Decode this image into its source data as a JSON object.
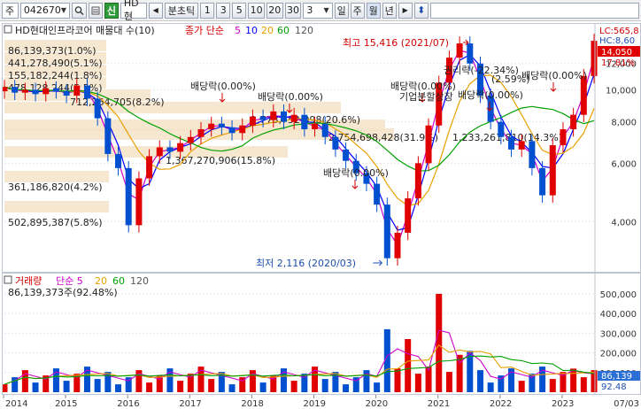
{
  "toolbar": {
    "market": "주",
    "code": "042670",
    "search_icon": "magnifier-icon",
    "credit_badge": "신",
    "name": "HD현",
    "period_prev": "◀",
    "period_label": "분초틱",
    "periods": [
      "1",
      "3",
      "5",
      "10",
      "20",
      "30"
    ],
    "count": "3",
    "day_label": "일",
    "week_label": "주",
    "month_label": "월",
    "year_label": "년",
    "next_arrow": "▶",
    "updown_icon": "updown-arrows-icon"
  },
  "price_panel": {
    "title": "HD현대인프라코어 매물대 수(10)",
    "legend_ma": [
      {
        "label": "종가 단순",
        "color": "#d80000"
      },
      {
        "label": "5",
        "color": "#cc00cc"
      },
      {
        "label": "10",
        "color": "#0000ff"
      },
      {
        "label": "20",
        "color": "#e8a000"
      },
      {
        "label": "60",
        "color": "#00a000"
      },
      {
        "label": "120",
        "color": "#555555"
      }
    ],
    "right_labels": {
      "lc": "LC:565,8",
      "hc": "HC:8,60",
      "current": "14,050",
      "ratio": "17.81%"
    },
    "y_ticks": [
      "12,000",
      "10,000",
      "8,000",
      "6,000",
      "4,000"
    ],
    "volume_profile": [
      "86,139,373(1.0%)",
      "441,278,490(5.1%)",
      "155,182,244(1.8%)",
      "478,128,244(5.5%)",
      "712,264,705(8.2%)",
      "1,778,752,098(20.6%)",
      "2,754,698,428(31.9%)",
      "1,233,261,810(14.3%)",
      "1,367,270,906(15.8%)",
      "361,186,820(4.2%)",
      "502,895,387(5.8%)"
    ],
    "dividend_labels": [
      "배당락(0.00%)",
      "배당락(0.00%)",
      "배당락(0.00%)",
      "배당락(0.00%)",
      "배당락(0.00%)",
      "배당락(0.00%)"
    ],
    "rights_label": "권리락(-22.34%)",
    "other_labels": [
      "(2.59%)",
      "기업분할상장",
      "배당락"
    ],
    "high_label": "최고 15,416 (2021/07)",
    "low_label": "최저 2,116 (2020/03)"
  },
  "volume_panel": {
    "title": "거래량",
    "legend": [
      {
        "label": "단순 5",
        "color": "#cc00cc"
      },
      {
        "label": "20",
        "color": "#e8a000"
      },
      {
        "label": "60",
        "color": "#00a000"
      },
      {
        "label": "120",
        "color": "#555555"
      }
    ],
    "current": "86,139,373주(92.48%)",
    "y_ticks": [
      "500,000",
      "400,000",
      "300,000",
      "200,000",
      "100,000"
    ],
    "right_labels": {
      "value": "86,139",
      "ratio": "92.48"
    }
  },
  "x_axis": {
    "labels": [
      "2014",
      "2015",
      "2016",
      "2017",
      "2018",
      "2019",
      "2020",
      "2021",
      "2022",
      "2023"
    ],
    "end_label": "07/03"
  },
  "colors": {
    "up": "#e00000",
    "down": "#0050d0",
    "profile": "#f5e3c8",
    "profile_text": "#7a4a00"
  },
  "chart_data": {
    "type": "candlestick",
    "title": "HD현대인프라코어 매물대 수(10)",
    "y_scale": "log",
    "y_range": [
      3000,
      14000
    ],
    "x_range": [
      "2014",
      "2023/07"
    ],
    "high": {
      "value": 15416,
      "date": "2021/07"
    },
    "low": {
      "value": 2116,
      "date": "2020/03"
    },
    "last_close": 14050,
    "monthly_close": [
      {
        "d": "2014-01",
        "c": 10200
      },
      {
        "d": "2014-03",
        "c": 9800
      },
      {
        "d": "2014-05",
        "c": 10000
      },
      {
        "d": "2014-07",
        "c": 9700
      },
      {
        "d": "2014-09",
        "c": 10100
      },
      {
        "d": "2014-11",
        "c": 9900
      },
      {
        "d": "2015-01",
        "c": 9600
      },
      {
        "d": "2015-03",
        "c": 10300
      },
      {
        "d": "2015-05",
        "c": 9400
      },
      {
        "d": "2015-07",
        "c": 8200
      },
      {
        "d": "2015-09",
        "c": 6400
      },
      {
        "d": "2015-11",
        "c": 5800
      },
      {
        "d": "2016-01",
        "c": 3900
      },
      {
        "d": "2016-03",
        "c": 5400
      },
      {
        "d": "2016-05",
        "c": 6300
      },
      {
        "d": "2016-07",
        "c": 6700
      },
      {
        "d": "2016-09",
        "c": 6500
      },
      {
        "d": "2016-11",
        "c": 6900
      },
      {
        "d": "2017-01",
        "c": 7200
      },
      {
        "d": "2017-03",
        "c": 7600
      },
      {
        "d": "2017-05",
        "c": 7900
      },
      {
        "d": "2017-07",
        "c": 7700
      },
      {
        "d": "2017-09",
        "c": 7400
      },
      {
        "d": "2017-11",
        "c": 7800
      },
      {
        "d": "2018-01",
        "c": 8300
      },
      {
        "d": "2018-03",
        "c": 8100
      },
      {
        "d": "2018-05",
        "c": 8600
      },
      {
        "d": "2018-07",
        "c": 8000
      },
      {
        "d": "2018-09",
        "c": 8400
      },
      {
        "d": "2018-11",
        "c": 7600
      },
      {
        "d": "2019-01",
        "c": 7900
      },
      {
        "d": "2019-03",
        "c": 7200
      },
      {
        "d": "2019-05",
        "c": 6600
      },
      {
        "d": "2019-07",
        "c": 6100
      },
      {
        "d": "2019-09",
        "c": 5600
      },
      {
        "d": "2019-11",
        "c": 5200
      },
      {
        "d": "2020-01",
        "c": 4500
      },
      {
        "d": "2020-03",
        "c": 3100
      },
      {
        "d": "2020-05",
        "c": 3700
      },
      {
        "d": "2020-07",
        "c": 4700
      },
      {
        "d": "2020-09",
        "c": 6000
      },
      {
        "d": "2020-11",
        "c": 7800
      },
      {
        "d": "2021-01",
        "c": 10500
      },
      {
        "d": "2021-03",
        "c": 12500
      },
      {
        "d": "2021-05",
        "c": 13800
      },
      {
        "d": "2021-07",
        "c": 12000
      },
      {
        "d": "2021-09",
        "c": 9600
      },
      {
        "d": "2021-11",
        "c": 8000
      },
      {
        "d": "2022-01",
        "c": 7200
      },
      {
        "d": "2022-03",
        "c": 6600
      },
      {
        "d": "2022-05",
        "c": 7000
      },
      {
        "d": "2022-07",
        "c": 5800
      },
      {
        "d": "2022-09",
        "c": 4800
      },
      {
        "d": "2022-11",
        "c": 6800
      },
      {
        "d": "2023-01",
        "c": 7600
      },
      {
        "d": "2023-03",
        "c": 8400
      },
      {
        "d": "2023-05",
        "c": 11000
      },
      {
        "d": "2023-07",
        "c": 14050
      }
    ],
    "volume_samples_thousands": [
      {
        "d": "2020-03",
        "v": 320000
      },
      {
        "d": "2020-07",
        "v": 270000
      },
      {
        "d": "2020-12",
        "v": 360000
      },
      {
        "d": "2021-01",
        "v": 500000
      },
      {
        "d": "2021-05",
        "v": 190000
      },
      {
        "d": "2021-07",
        "v": 210000
      },
      {
        "d": "2023-03",
        "v": 120000
      },
      {
        "d": "2023-06",
        "v": 92000
      }
    ]
  }
}
